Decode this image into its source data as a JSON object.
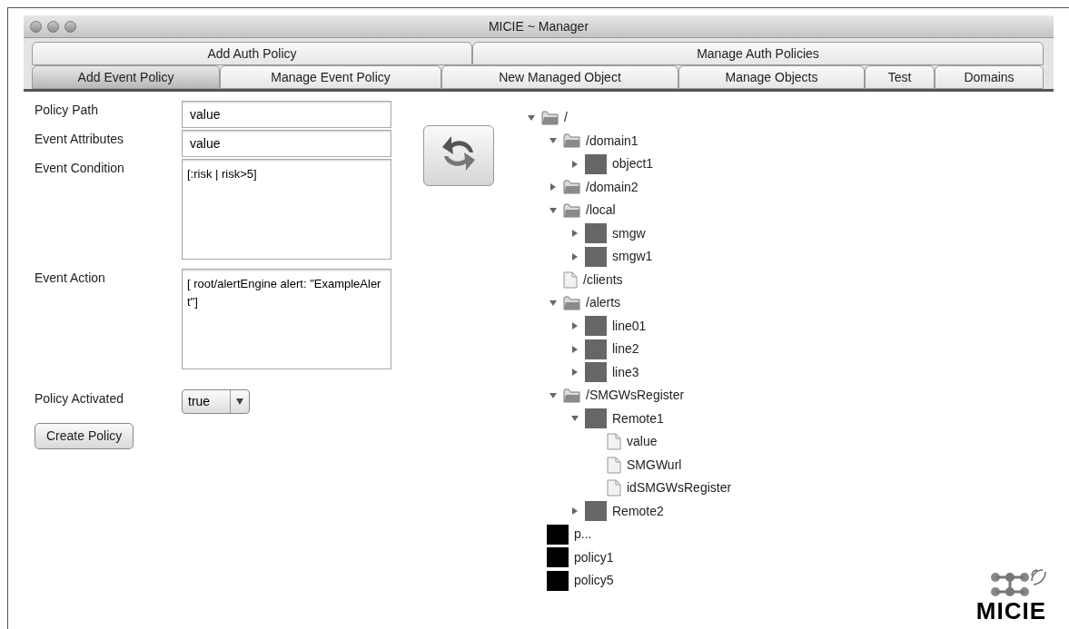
{
  "window": {
    "title": "MICIE ~ Manager"
  },
  "tab_rows": [
    [
      {
        "label": "Add Auth Policy",
        "selected": false
      },
      {
        "label": "Manage Auth Policies",
        "selected": false
      }
    ],
    [
      {
        "label": "Add Event Policy",
        "selected": true
      },
      {
        "label": "Manage Event Policy",
        "selected": false
      },
      {
        "label": "New Managed Object",
        "selected": false
      },
      {
        "label": "Manage Objects",
        "selected": false
      },
      {
        "label": "Test",
        "selected": false
      },
      {
        "label": "Domains",
        "selected": false
      }
    ]
  ],
  "form": [
    {
      "kind": "text",
      "label": "Policy Path",
      "value": "value"
    },
    {
      "kind": "text",
      "label": "Event Attributes",
      "value": "value"
    },
    {
      "kind": "area",
      "label": "Event Condition",
      "value": "[:risk | risk>5]"
    },
    {
      "kind": "area",
      "label": "Event Action",
      "value": "[ root/alertEngine alert: \"ExampleAlert\"]"
    },
    {
      "kind": "select",
      "label": "Policy Activated",
      "value": "true"
    }
  ],
  "create_button": "Create Policy",
  "tree": [
    {
      "kind": "folder",
      "label": "/",
      "expanded": true,
      "children": [
        {
          "kind": "folder",
          "label": "/domain1",
          "expanded": true,
          "children": [
            {
              "kind": "object",
              "label": "object1",
              "expanded": false
            }
          ]
        },
        {
          "kind": "folder",
          "label": "/domain2",
          "expanded": false
        },
        {
          "kind": "folder",
          "label": "/local",
          "expanded": true,
          "children": [
            {
              "kind": "object",
              "label": "smgw",
              "expanded": false
            },
            {
              "kind": "object",
              "label": "smgw1",
              "expanded": false
            }
          ]
        },
        {
          "kind": "file",
          "label": "/clients"
        },
        {
          "kind": "folder",
          "label": "/alerts",
          "expanded": true,
          "children": [
            {
              "kind": "object",
              "label": "line01",
              "expanded": false
            },
            {
              "kind": "object",
              "label": "line2",
              "expanded": false
            },
            {
              "kind": "object",
              "label": "line3",
              "expanded": false
            }
          ]
        },
        {
          "kind": "folder",
          "label": "/SMGWsRegister",
          "expanded": true,
          "children": [
            {
              "kind": "object",
              "label": "Remote1",
              "expanded": true,
              "children": [
                {
                  "kind": "file",
                  "label": "value"
                },
                {
                  "kind": "file",
                  "label": "SMGWurl"
                },
                {
                  "kind": "file",
                  "label": "idSMGWsRegister"
                }
              ]
            },
            {
              "kind": "object",
              "label": "Remote2",
              "expanded": false
            }
          ]
        },
        {
          "kind": "policy",
          "label": "p..."
        },
        {
          "kind": "policy",
          "label": "policy1"
        },
        {
          "kind": "policy",
          "label": "policy5"
        }
      ]
    }
  ],
  "logo_text": "MICIE"
}
